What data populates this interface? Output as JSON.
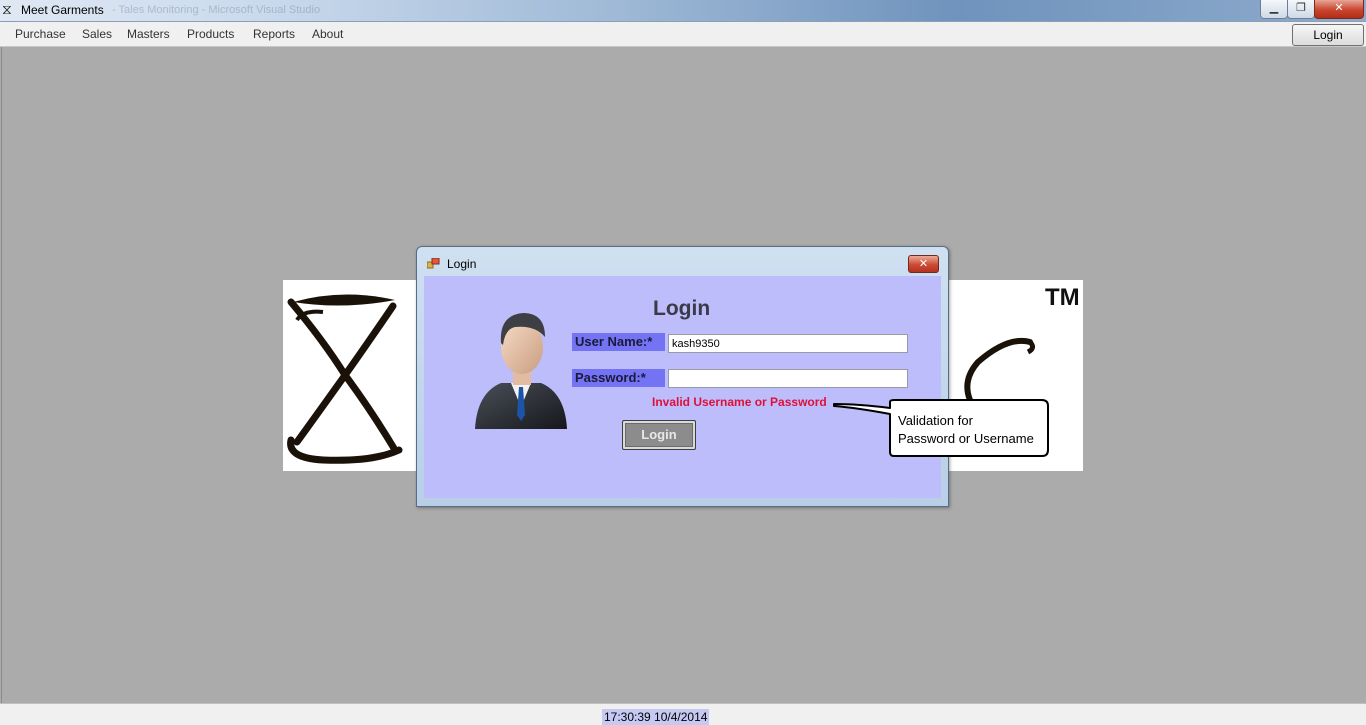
{
  "window": {
    "title": "Meet Garments",
    "ghost_title": "- Tales Monitoring - Microsoft Visual Studio",
    "min_glyph": "▁",
    "max_glyph": "❐",
    "close_glyph": "✕"
  },
  "menu": {
    "items": [
      "Purchase",
      "Sales",
      "Masters",
      "Products",
      "Reports",
      "About"
    ],
    "login_button": "Login"
  },
  "logo": {
    "trademark": "TM"
  },
  "dialog": {
    "title": "Login",
    "close_glyph": "✕",
    "heading": "Login",
    "username_label": "User Name:*",
    "username_value": "kash9350",
    "password_label": "Password:*",
    "password_value": "",
    "error_message": "Invalid Username or Password",
    "login_button": "Login"
  },
  "callout": {
    "line1": "Validation for",
    "line2": "Password or Username"
  },
  "status": {
    "datetime": "17:30:39 10/4/2014"
  },
  "icons": {
    "app": "hourglass-icon",
    "dialog": "windows-form-icon",
    "avatar": "businessman-avatar-icon"
  },
  "colors": {
    "dialog_client": "#bdbdfb",
    "label_bg": "#7373f3",
    "error": "#e0103a",
    "workspace": "#ababab"
  }
}
